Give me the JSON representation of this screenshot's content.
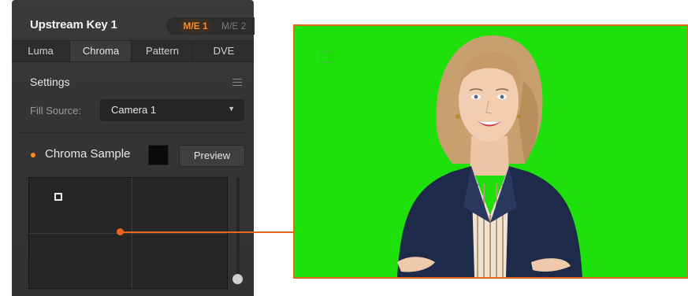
{
  "panel": {
    "title": "Upstream Key 1",
    "me_tabs": [
      {
        "label": "M/E 1",
        "active": true
      },
      {
        "label": "M/E 2",
        "active": false
      }
    ],
    "key_tabs": [
      {
        "label": "Luma",
        "active": false
      },
      {
        "label": "Chroma",
        "active": true
      },
      {
        "label": "Pattern",
        "active": false
      },
      {
        "label": "DVE",
        "active": false
      }
    ],
    "settings_label": "Settings",
    "fill_source": {
      "label": "Fill Source:",
      "value": "Camera 1"
    },
    "chroma_sample": {
      "label": "Chroma Sample",
      "swatch_color": "#0a0a0a",
      "preview_label": "Preview"
    }
  },
  "icons": {
    "menu": "hamburger-icon",
    "dropdown": "chevron-down-icon",
    "status": "status-dot-icon",
    "sample_box": "sample-box-icon"
  },
  "colors": {
    "accent": "#ff8a1f",
    "callout": "#e8641f",
    "green_screen": "#1ee00a",
    "panel_bg": "#363636"
  }
}
